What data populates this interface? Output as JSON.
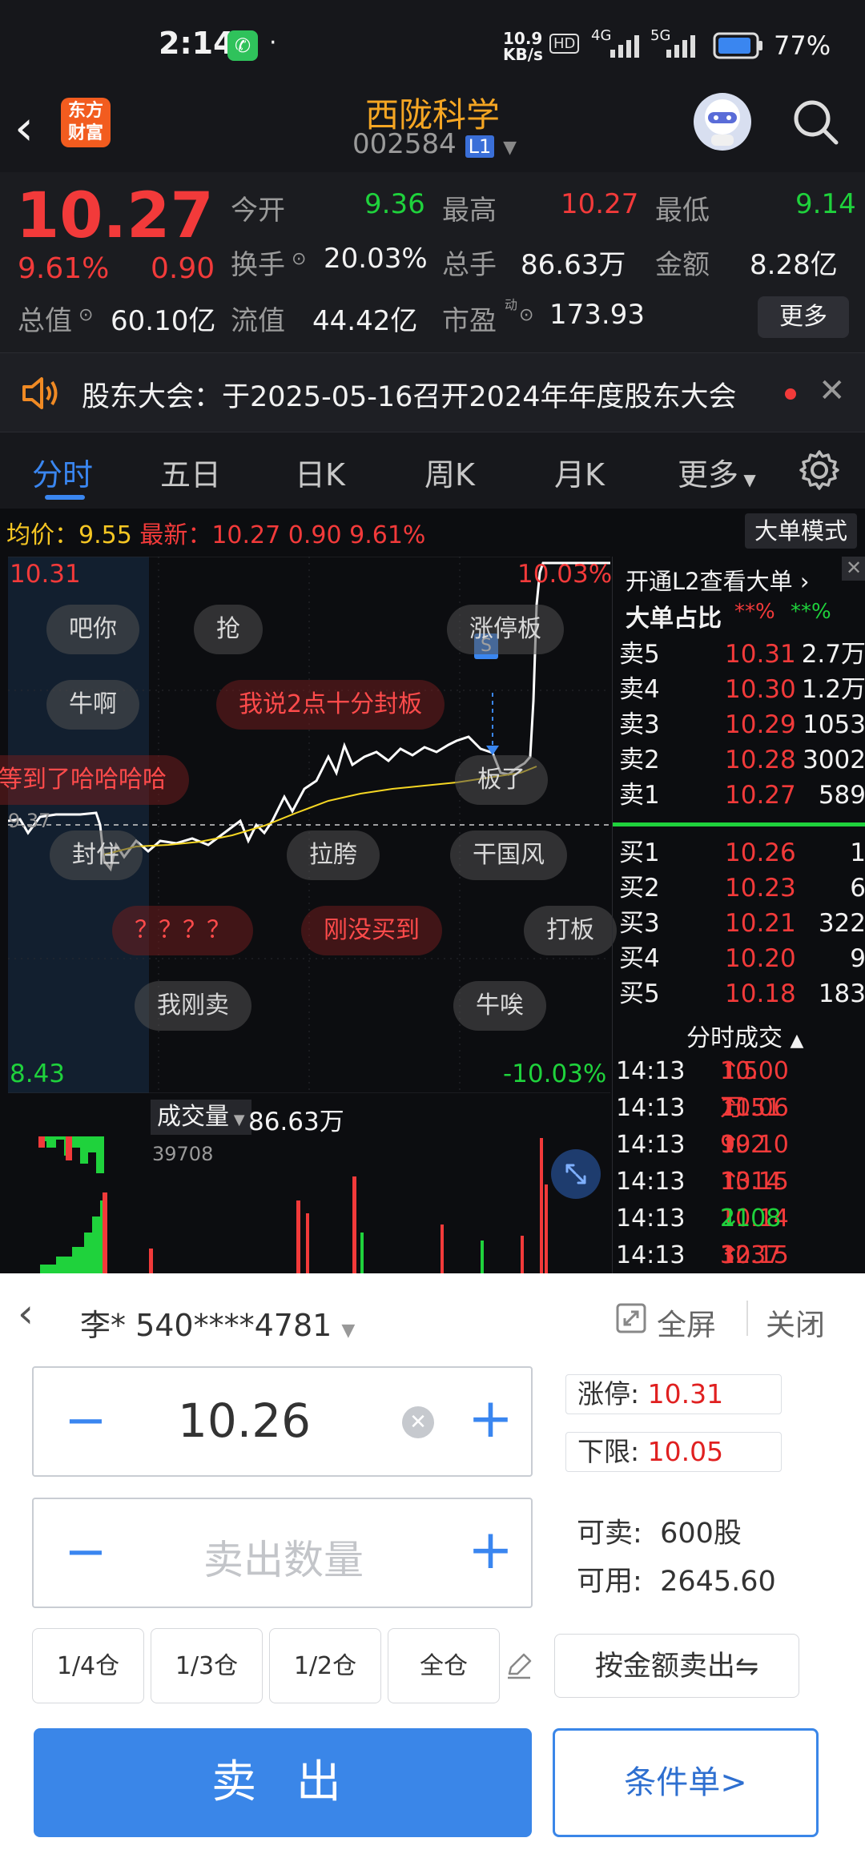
{
  "status_bar": {
    "time": "2:14",
    "net_speed_top": "10.9",
    "net_speed_bottom": "KB/s",
    "hd": "HD",
    "signal1": "4G",
    "signal2": "5G",
    "battery": "77%"
  },
  "header": {
    "logo_line1": "东方",
    "logo_line2": "财富",
    "title": "西陇科学",
    "code": "002584",
    "level": "L1"
  },
  "quote": {
    "price": "10.27",
    "pct": "9.61%",
    "change": "0.90",
    "open_label": "今开",
    "open": "9.36",
    "high_label": "最高",
    "high": "10.27",
    "low_label": "最低",
    "low": "9.14",
    "turnover_label": "换手",
    "turnover": "20.03%",
    "volume_label": "总手",
    "volume": "86.63万",
    "amount_label": "金额",
    "amount": "8.28亿",
    "mktcap_label": "总值",
    "mktcap": "60.10亿",
    "float_label": "流值",
    "float": "44.42亿",
    "pe_label": "市盈",
    "pe_sup": "动",
    "pe": "173.93",
    "more": "更多"
  },
  "notice": {
    "text": "股东大会：于2025-05-16召开2024年年度股东大会"
  },
  "tabs": {
    "items": [
      "分时",
      "五日",
      "日K",
      "周K",
      "月K",
      "更多"
    ],
    "active": "分时"
  },
  "chart_info": {
    "avg_label": "均价：",
    "avg": "9.55",
    "last_label": "最新：",
    "last": "10.27",
    "chg": "0.90",
    "pct": "9.61%",
    "mode_btn": "大单模式"
  },
  "chart_labels": {
    "y_top": "10.31",
    "y_top_pct": "10.03%",
    "y_bottom": "8.43",
    "y_bottom_pct": "-10.03%",
    "mid": "9.37",
    "s_marker": "S"
  },
  "danmu": [
    {
      "text": "吧你",
      "style": "gray"
    },
    {
      "text": "抢",
      "style": "gray"
    },
    {
      "text": "涨停板",
      "style": "gray"
    },
    {
      "text": "牛啊",
      "style": "gray"
    },
    {
      "text": "我说2点十分封板",
      "style": "red"
    },
    {
      "text": "等到了哈哈哈哈",
      "style": "red"
    },
    {
      "text": "板了",
      "style": "gray"
    },
    {
      "text": "封住",
      "style": "gray"
    },
    {
      "text": "拉胯",
      "style": "gray"
    },
    {
      "text": "干国风",
      "style": "gray"
    },
    {
      "text": "？？？？",
      "style": "red"
    },
    {
      "text": "刚没买到",
      "style": "red"
    },
    {
      "text": "打板",
      "style": "gray"
    },
    {
      "text": "我刚卖",
      "style": "gray"
    },
    {
      "text": "牛唉",
      "style": "gray"
    }
  ],
  "volume_bar": {
    "label": "成交量",
    "value": "86.63万",
    "max": "39708"
  },
  "orderbook": {
    "l2_link": "开通L2查看大单",
    "ratio_label": "大单占比",
    "ratio_red": "**%",
    "ratio_green": "**%",
    "asks": [
      {
        "label": "卖5",
        "price": "10.31",
        "vol": "2.7万"
      },
      {
        "label": "卖4",
        "price": "10.30",
        "vol": "1.2万"
      },
      {
        "label": "卖3",
        "price": "10.29",
        "vol": "1053"
      },
      {
        "label": "卖2",
        "price": "10.28",
        "vol": "3002"
      },
      {
        "label": "卖1",
        "price": "10.27",
        "vol": "589"
      }
    ],
    "bids": [
      {
        "label": "买1",
        "price": "10.26",
        "vol": "1"
      },
      {
        "label": "买2",
        "price": "10.23",
        "vol": "6"
      },
      {
        "label": "买3",
        "price": "10.21",
        "vol": "322"
      },
      {
        "label": "买4",
        "price": "10.20",
        "vol": "9"
      },
      {
        "label": "买5",
        "price": "10.18",
        "vol": "183"
      }
    ],
    "ticks_title": "分时成交",
    "ticks": [
      {
        "time": "14:13",
        "price": "10.00",
        "dir": "↑",
        "vol": "1.5万",
        "color": "red"
      },
      {
        "time": "14:13",
        "price": "10.06",
        "dir": "↑",
        "vol": "1151",
        "color": "red"
      },
      {
        "time": "14:13",
        "price": "10.10",
        "dir": "↑",
        "vol": "992",
        "color": "red"
      },
      {
        "time": "14:13",
        "price": "10.15",
        "dir": "↑",
        "vol": "1314",
        "color": "red"
      },
      {
        "time": "14:13",
        "price": "10.14",
        "dir": "↓",
        "vol": "2108",
        "color": "green"
      },
      {
        "time": "14:13",
        "price": "10.15",
        "dir": "↑",
        "vol": "3237",
        "color": "red"
      }
    ]
  },
  "trade": {
    "account": "李* 540****4781",
    "fullscreen": "全屏",
    "close": "关闭",
    "price": "10.26",
    "qty_placeholder": "卖出数量",
    "limit_up_label": "涨停:",
    "limit_up": "10.31",
    "limit_down_label": "下限:",
    "limit_down": "10.05",
    "sellable_label": "可卖:",
    "sellable": "600股",
    "available_label": "可用:",
    "available": "2645.60",
    "positions": [
      "1/4仓",
      "1/3仓",
      "1/2仓",
      "全仓"
    ],
    "by_amount": "按金额卖出⇋",
    "sell": "卖 出",
    "condition": "条件单>"
  },
  "colors": {
    "up": "#f23a3a",
    "down": "#1fd23c",
    "accent": "#3a86f0",
    "gold": "#f5a623"
  }
}
